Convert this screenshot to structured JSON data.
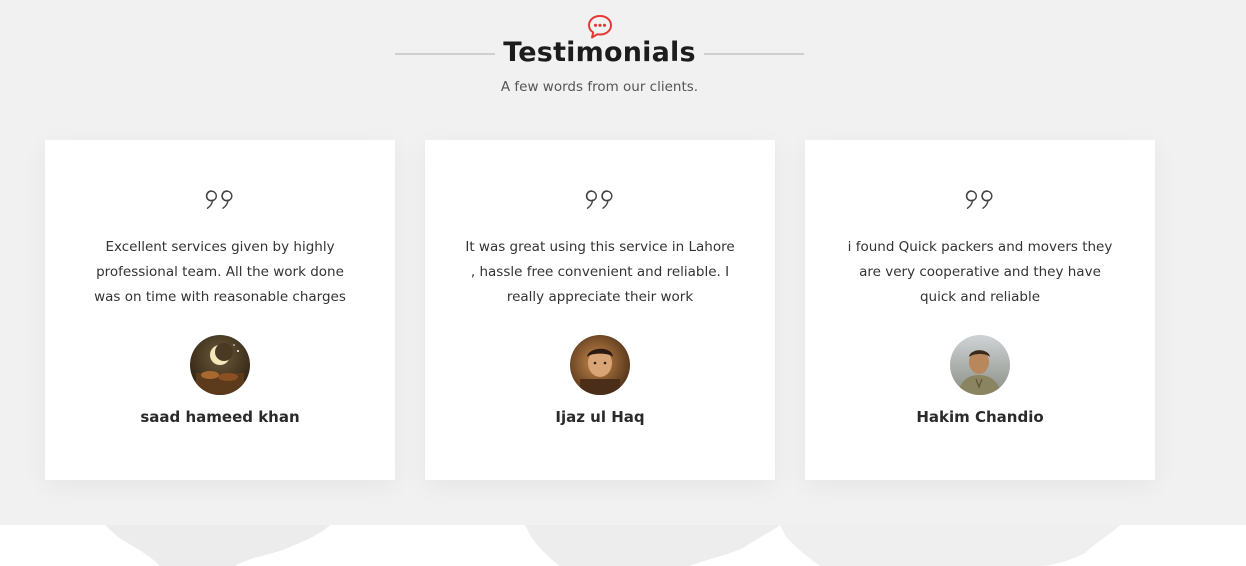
{
  "header": {
    "icon": "chat-bubble-icon",
    "title": "Testimonials",
    "subtitle": "A few words from our clients."
  },
  "testimonials": [
    {
      "text": "Excellent services given by highly professional team. All the work done was on time with reasonable charges",
      "name": "saad hameed khan",
      "avatar": "avatar-crescent-moon"
    },
    {
      "text": "It was great using this service in Lahore , hassle free convenient and reliable. I really appreciate their work",
      "name": "Ijaz ul Haq",
      "avatar": "avatar-man-portrait"
    },
    {
      "text": "i found Quick packers and movers they are very cooperative and they have quick and reliable",
      "name": "Hakim Chandio",
      "avatar": "avatar-man-outdoor"
    }
  ],
  "colors": {
    "accent": "#e53935",
    "section_bg": "#f1f1f1",
    "card_bg": "#ffffff",
    "title": "#1c1c1c"
  }
}
